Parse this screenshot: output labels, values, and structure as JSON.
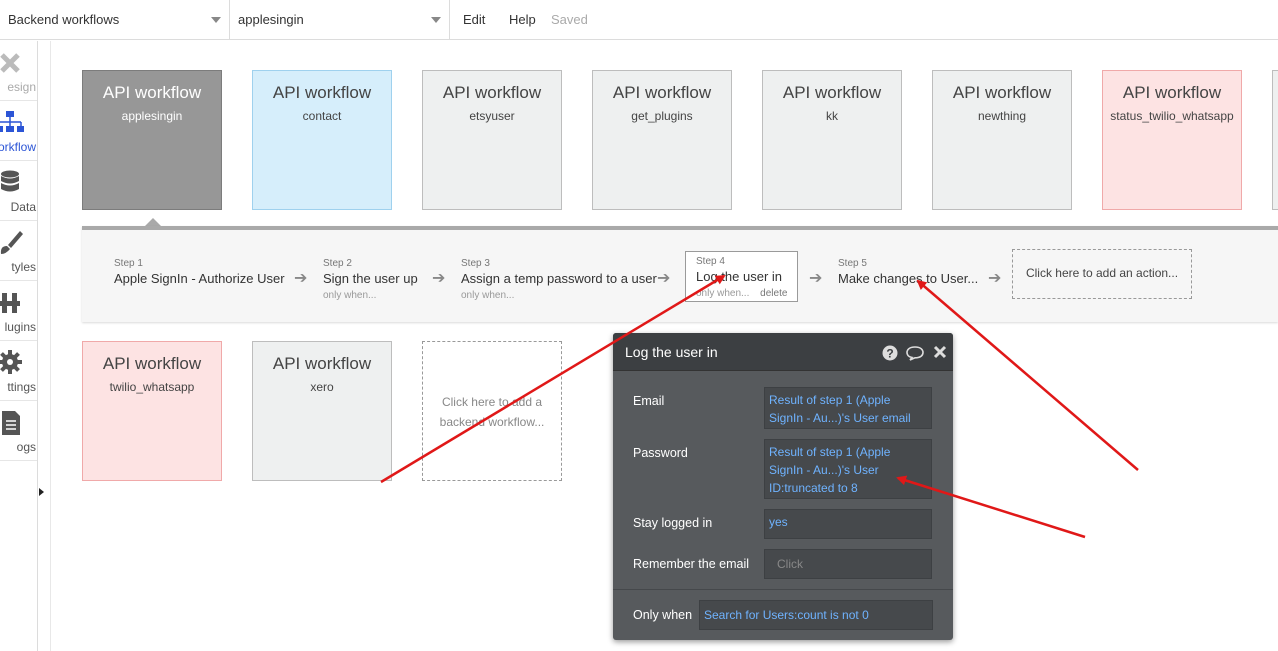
{
  "topbar": {
    "workflow_select": "Backend workflows",
    "page_select": "applesingin",
    "menu_edit": "Edit",
    "menu_help": "Help",
    "status": "Saved"
  },
  "sidebar": {
    "items": [
      {
        "label": "esign"
      },
      {
        "label": "orkflow"
      },
      {
        "label": "Data"
      },
      {
        "label": "tyles"
      },
      {
        "label": "lugins"
      },
      {
        "label": "ttings"
      },
      {
        "label": "ogs"
      }
    ]
  },
  "workflows_row1": [
    {
      "title": "API workflow",
      "name": "applesingin"
    },
    {
      "title": "API workflow",
      "name": "contact"
    },
    {
      "title": "API workflow",
      "name": "etsyuser"
    },
    {
      "title": "API workflow",
      "name": "get_plugins"
    },
    {
      "title": "API workflow",
      "name": "kk"
    },
    {
      "title": "API workflow",
      "name": "newthing"
    },
    {
      "title": "API workflow",
      "name": "status_twilio_whatsapp"
    }
  ],
  "workflows_row2": [
    {
      "title": "API workflow",
      "name": "twilio_whatsapp"
    },
    {
      "title": "API workflow",
      "name": "xero"
    }
  ],
  "add_workflow_label": "Click here to add a backend workflow...",
  "steps": [
    {
      "number": "Step 1",
      "label": "Apple SignIn - Authorize User",
      "condition": ""
    },
    {
      "number": "Step 2",
      "label": "Sign the user up",
      "condition": "only when..."
    },
    {
      "number": "Step 3",
      "label": "Assign a temp password to a user",
      "condition": "only when..."
    },
    {
      "number": "Step 4",
      "label": "Log the user in",
      "condition": "only when...",
      "delete": "delete"
    },
    {
      "number": "Step 5",
      "label": "Make changes to User...",
      "condition": ""
    }
  ],
  "add_action_label": "Click here to add an action...",
  "property_editor": {
    "title": "Log the user in",
    "fields": {
      "email_label": "Email",
      "email_value": "Result of step 1 (Apple SignIn - Au...)'s User email",
      "password_label": "Password",
      "password_value": "Result of step 1 (Apple SignIn - Au...)'s User ID:truncated to 8",
      "stay_label": "Stay logged in",
      "stay_value": "yes",
      "remember_label": "Remember the email",
      "remember_value": "Click",
      "only_when_label": "Only when",
      "only_when_value": "Search for Users:count is not 0"
    }
  },
  "colors": {
    "accent_blue": "#2c55d6",
    "expression_blue": "#6fb3ff",
    "annotation_red": "#e01818",
    "selected_card": "#979797",
    "popup_bg": "#575a5d"
  }
}
